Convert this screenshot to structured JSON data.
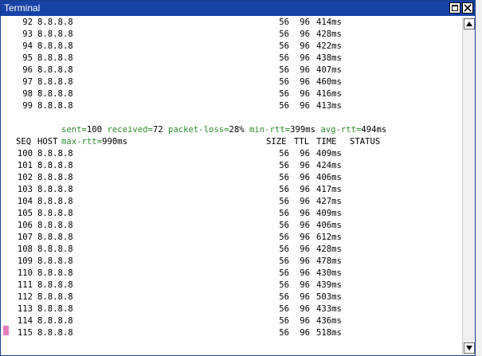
{
  "window": {
    "title": "Terminal"
  },
  "ping_rows_top": [
    {
      "seq": "92",
      "host": "8.8.8.8",
      "size": "56",
      "ttl": "96",
      "time": "414ms"
    },
    {
      "seq": "93",
      "host": "8.8.8.8",
      "size": "56",
      "ttl": "96",
      "time": "428ms"
    },
    {
      "seq": "94",
      "host": "8.8.8.8",
      "size": "56",
      "ttl": "96",
      "time": "422ms"
    },
    {
      "seq": "95",
      "host": "8.8.8.8",
      "size": "56",
      "ttl": "96",
      "time": "438ms"
    },
    {
      "seq": "96",
      "host": "8.8.8.8",
      "size": "56",
      "ttl": "96",
      "time": "407ms"
    },
    {
      "seq": "97",
      "host": "8.8.8.8",
      "size": "56",
      "ttl": "96",
      "time": "460ms"
    },
    {
      "seq": "98",
      "host": "8.8.8.8",
      "size": "56",
      "ttl": "96",
      "time": "416ms"
    },
    {
      "seq": "99",
      "host": "8.8.8.8",
      "size": "56",
      "ttl": "96",
      "time": "413ms"
    }
  ],
  "statistics": {
    "sent_label": "sent=",
    "sent": "100",
    "received_label": " received=",
    "received": "72",
    "loss_label": " packet-loss=",
    "loss": "28%",
    "min_label": " min-rtt=",
    "min": "399ms",
    "avg_label": " avg-rtt=",
    "avg": "494ms",
    "max_label": "max-rtt=",
    "max": "990ms"
  },
  "header": {
    "seq": "SEQ",
    "host": "HOST",
    "size": "SIZE",
    "ttl": "TTL",
    "time": "TIME",
    "status": "STATUS"
  },
  "ping_rows_bottom": [
    {
      "seq": "100",
      "host": "8.8.8.8",
      "size": "56",
      "ttl": "96",
      "time": "409ms"
    },
    {
      "seq": "101",
      "host": "8.8.8.8",
      "size": "56",
      "ttl": "96",
      "time": "424ms"
    },
    {
      "seq": "102",
      "host": "8.8.8.8",
      "size": "56",
      "ttl": "96",
      "time": "406ms"
    },
    {
      "seq": "103",
      "host": "8.8.8.8",
      "size": "56",
      "ttl": "96",
      "time": "417ms"
    },
    {
      "seq": "104",
      "host": "8.8.8.8",
      "size": "56",
      "ttl": "96",
      "time": "427ms"
    },
    {
      "seq": "105",
      "host": "8.8.8.8",
      "size": "56",
      "ttl": "96",
      "time": "409ms"
    },
    {
      "seq": "106",
      "host": "8.8.8.8",
      "size": "56",
      "ttl": "96",
      "time": "406ms"
    },
    {
      "seq": "107",
      "host": "8.8.8.8",
      "size": "56",
      "ttl": "96",
      "time": "612ms"
    },
    {
      "seq": "108",
      "host": "8.8.8.8",
      "size": "56",
      "ttl": "96",
      "time": "428ms"
    },
    {
      "seq": "109",
      "host": "8.8.8.8",
      "size": "56",
      "ttl": "96",
      "time": "478ms"
    },
    {
      "seq": "110",
      "host": "8.8.8.8",
      "size": "56",
      "ttl": "96",
      "time": "430ms"
    },
    {
      "seq": "111",
      "host": "8.8.8.8",
      "size": "56",
      "ttl": "96",
      "time": "439ms"
    },
    {
      "seq": "112",
      "host": "8.8.8.8",
      "size": "56",
      "ttl": "96",
      "time": "503ms"
    },
    {
      "seq": "113",
      "host": "8.8.8.8",
      "size": "56",
      "ttl": "96",
      "time": "433ms"
    },
    {
      "seq": "114",
      "host": "8.8.8.8",
      "size": "56",
      "ttl": "96",
      "time": "436ms"
    },
    {
      "seq": "115",
      "host": "8.8.8.8",
      "size": "56",
      "ttl": "96",
      "time": "518ms"
    }
  ],
  "icons": {
    "maximize": "maximize-icon",
    "close": "close-icon",
    "scroll_up": "arrow-up-icon",
    "scroll_down": "arrow-down-icon"
  },
  "colors": {
    "titlebar": "#1742a8",
    "stat_label": "#2d8a2d",
    "cursor": "#e87cb9"
  }
}
